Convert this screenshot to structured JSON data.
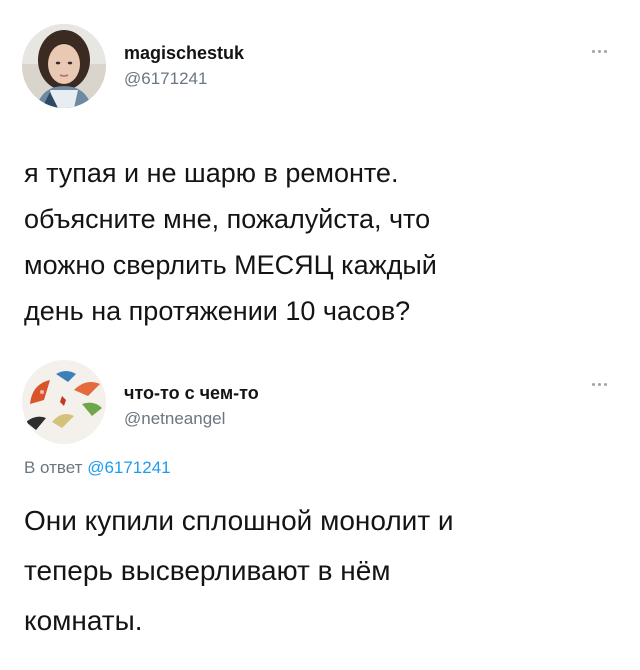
{
  "tweets": [
    {
      "display_name": "magischestuk",
      "handle": "@6171241",
      "text_lines": [
        "я тупая и не шарю в ремонте.",
        "объясните мне, пожалуйста, что",
        "можно сверлить МЕСЯЦ каждый",
        "день на протяжении 10 часов?"
      ],
      "avatar_icon": "woman-portrait-avatar",
      "more_icon": "more-options-icon"
    },
    {
      "display_name": "что-то с чем-то",
      "handle": "@netneangel",
      "reply_prefix": "В ответ",
      "reply_mention": "@6171241",
      "text_lines": [
        "Они купили сплошной монолит и",
        "теперь высверливают в нём",
        "комнаты."
      ],
      "avatar_icon": "umbrellas-avatar",
      "more_icon": "more-options-icon"
    }
  ],
  "colors": {
    "text": "#141414",
    "secondary": "#6b7680",
    "mention": "#1d9bf0",
    "background": "#ffffff"
  }
}
